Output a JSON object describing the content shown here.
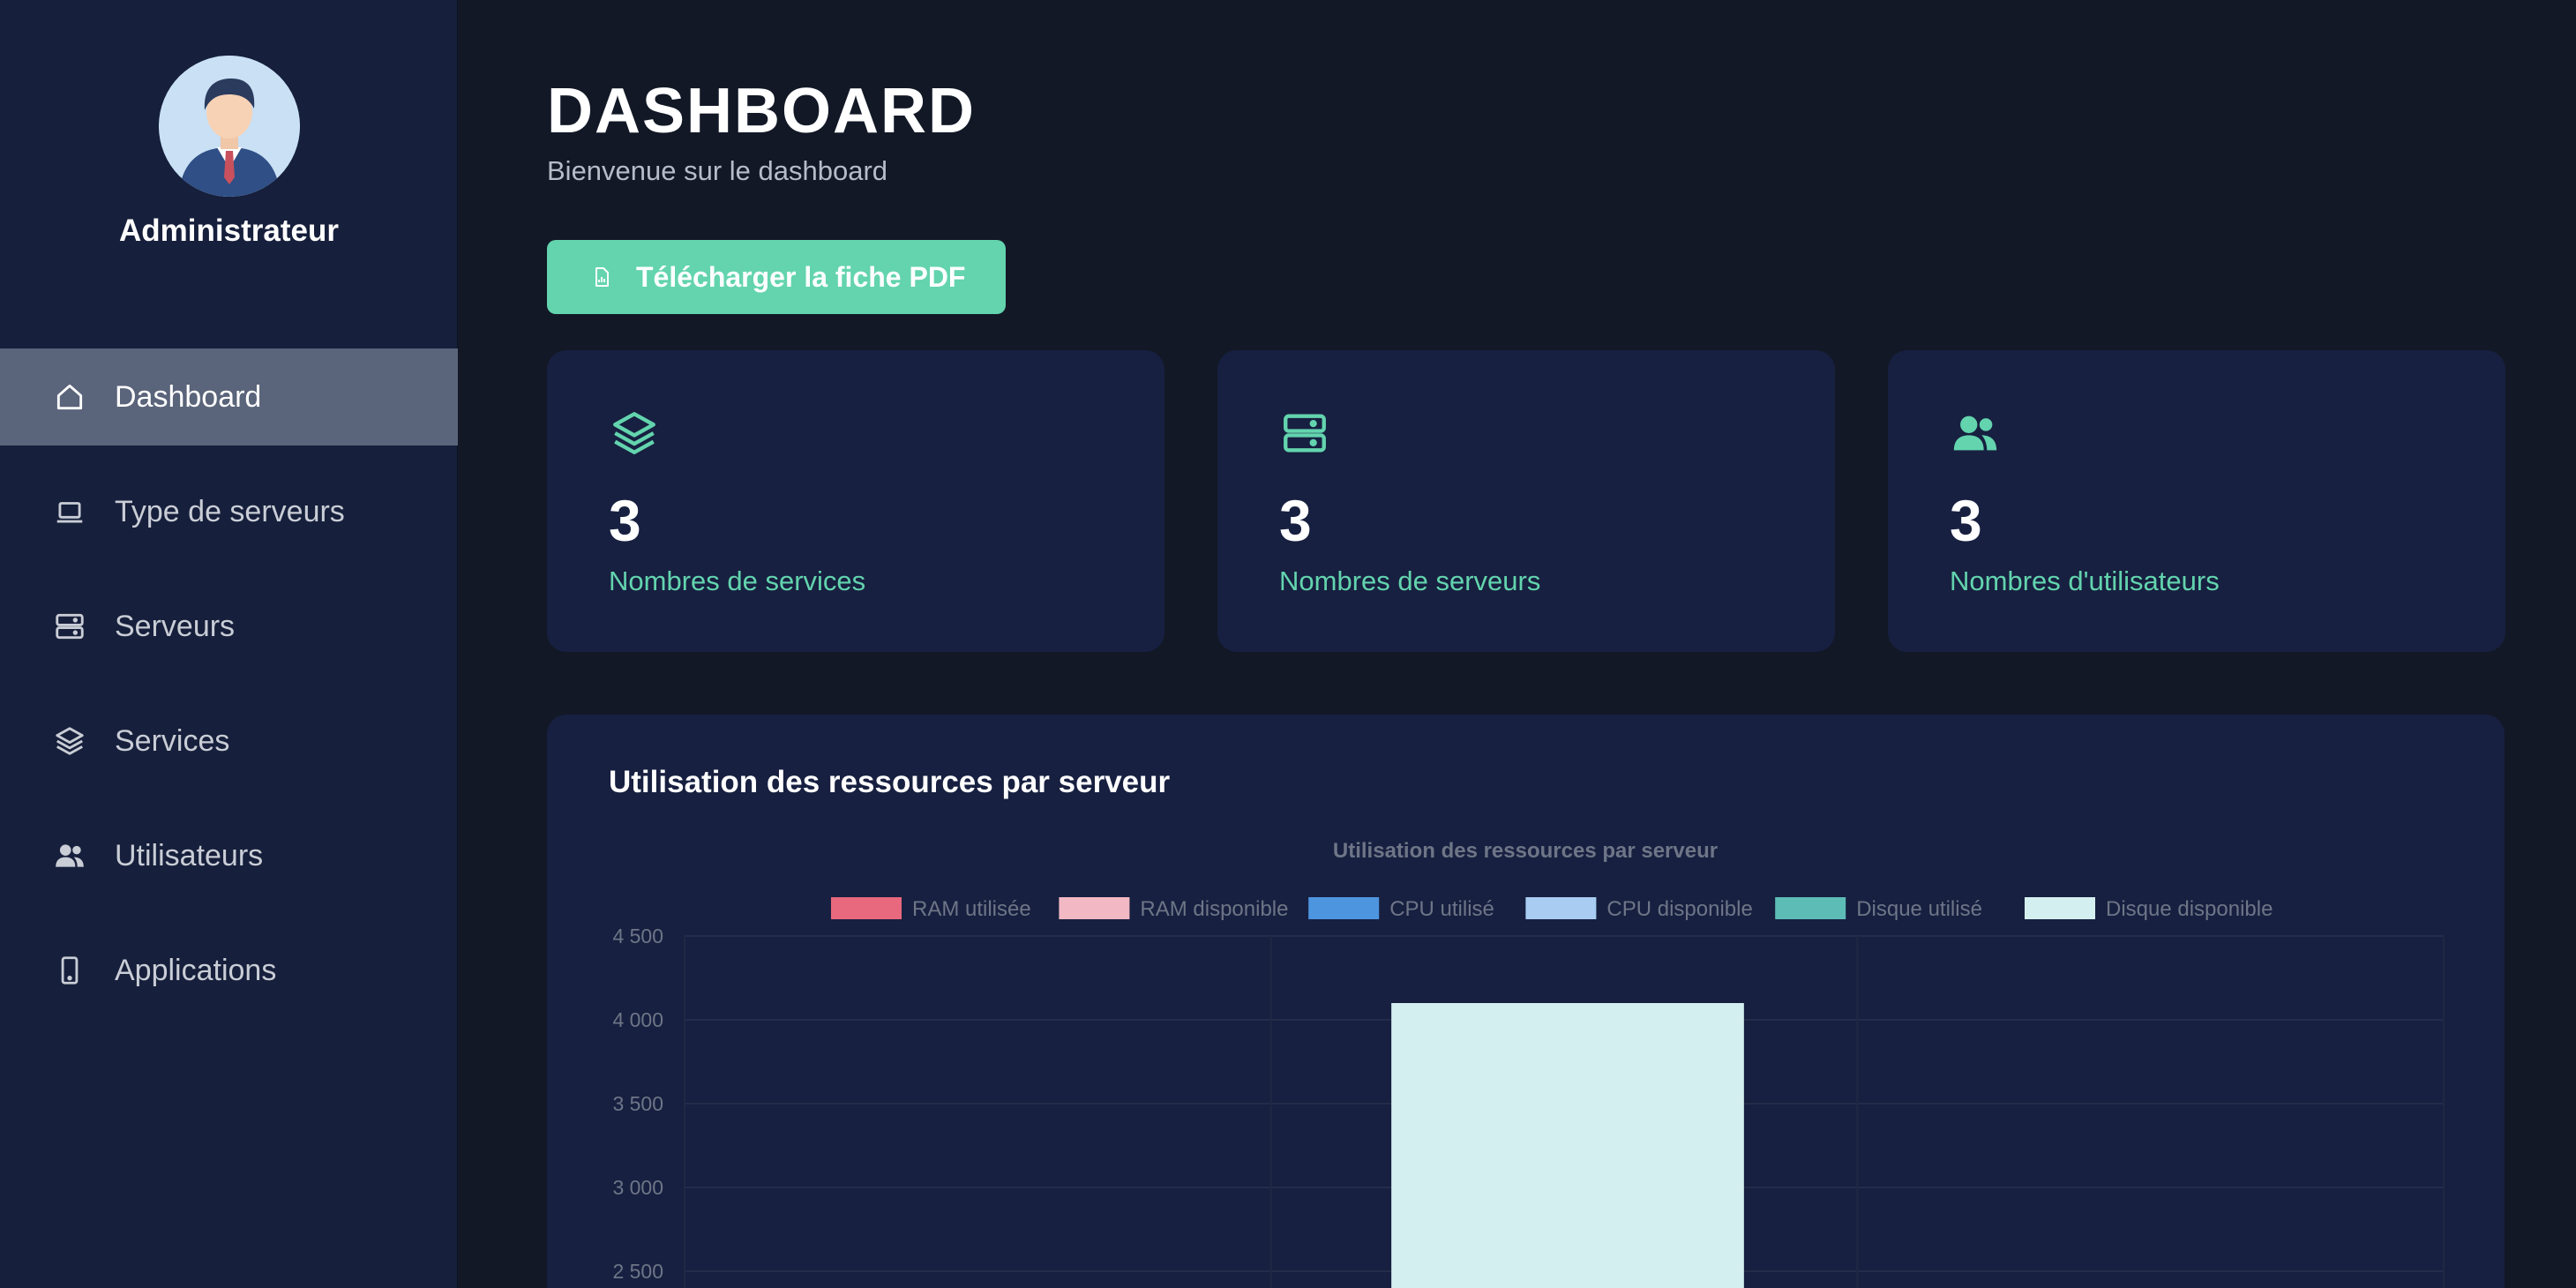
{
  "sidebar": {
    "user_name": "Administrateur",
    "items": [
      {
        "label": "Dashboard",
        "icon": "home-icon",
        "active": true
      },
      {
        "label": "Type de serveurs",
        "icon": "laptop-icon",
        "active": false
      },
      {
        "label": "Serveurs",
        "icon": "server-icon",
        "active": false
      },
      {
        "label": "Services",
        "icon": "layers-icon",
        "active": false
      },
      {
        "label": "Utilisateurs",
        "icon": "users-icon",
        "active": false
      },
      {
        "label": "Applications",
        "icon": "mobile-icon",
        "active": false
      }
    ]
  },
  "header": {
    "title": "DASHBOARD",
    "subtitle": "Bienvenue sur le dashboard"
  },
  "pdf_button": {
    "label": "Télécharger la fiche PDF",
    "icon": "file-chart-icon"
  },
  "stats": [
    {
      "value": "3",
      "label": "Nombres de services",
      "icon": "layers-icon"
    },
    {
      "value": "3",
      "label": "Nombres de serveurs",
      "icon": "server-icon"
    },
    {
      "value": "3",
      "label": "Nombres d'utilisateurs",
      "icon": "users-icon"
    }
  ],
  "colors": {
    "accent": "#63d4ae",
    "sidebar_bg": "#161f3b",
    "main_bg": "#121826",
    "card_bg": "#172040"
  },
  "chart_section": {
    "heading": "Utilisation des ressources par serveur"
  },
  "chart_data": {
    "type": "bar",
    "title": "Utilisation des ressources par serveur",
    "legend_position": "top",
    "grid": true,
    "ylim": [
      2500,
      4500
    ],
    "y_ticks": [
      "4 500",
      "4 000",
      "3 500",
      "3 000",
      "2 500"
    ],
    "category_count": 3,
    "series": [
      {
        "name": "RAM utilisée",
        "color": "#e8687e",
        "values": [
          null,
          null,
          null
        ]
      },
      {
        "name": "RAM disponible",
        "color": "#f2b8c4",
        "values": [
          null,
          null,
          null
        ]
      },
      {
        "name": "CPU utilisé",
        "color": "#4e95e0",
        "values": [
          null,
          null,
          null
        ]
      },
      {
        "name": "CPU disponible",
        "color": "#a9cdf2",
        "values": [
          null,
          null,
          null
        ]
      },
      {
        "name": "Disque utilisé",
        "color": "#5ebcb6",
        "values": [
          null,
          null,
          null
        ]
      },
      {
        "name": "Disque disponible",
        "color": "#d4eff0",
        "values": [
          null,
          4100,
          null
        ]
      }
    ]
  }
}
